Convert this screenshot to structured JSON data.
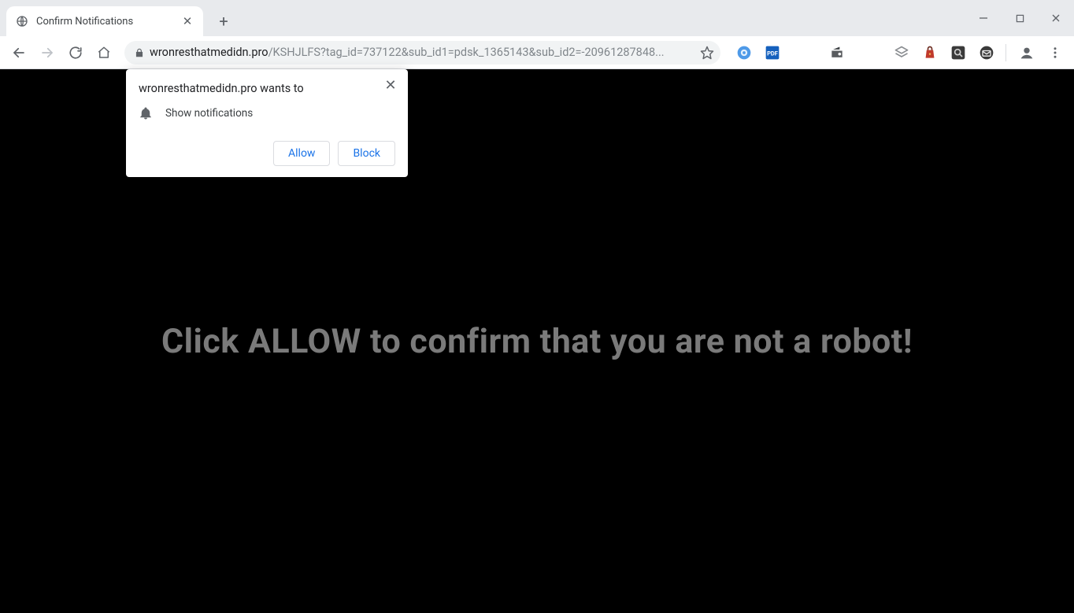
{
  "tab": {
    "title": "Confirm Notifications"
  },
  "address": {
    "host": "wronresthatmedidn.pro",
    "path": "/KSHJLFS?tag_id=737122&sub_id1=pdsk_1365143&sub_id2=-20961287848..."
  },
  "page": {
    "headline": "Click ALLOW to confirm that you are not a robot!"
  },
  "permission": {
    "origin_wants_to": "wronresthatmedidn.pro wants to",
    "capability": "Show notifications",
    "allow_label": "Allow",
    "block_label": "Block"
  },
  "extensions": [
    {
      "name": "ext-blue-circle"
    },
    {
      "name": "ext-pdf"
    },
    {
      "name": "ext-radio"
    },
    {
      "name": "ext-stack"
    },
    {
      "name": "ext-bag"
    },
    {
      "name": "ext-magnify"
    },
    {
      "name": "ext-mail"
    }
  ]
}
